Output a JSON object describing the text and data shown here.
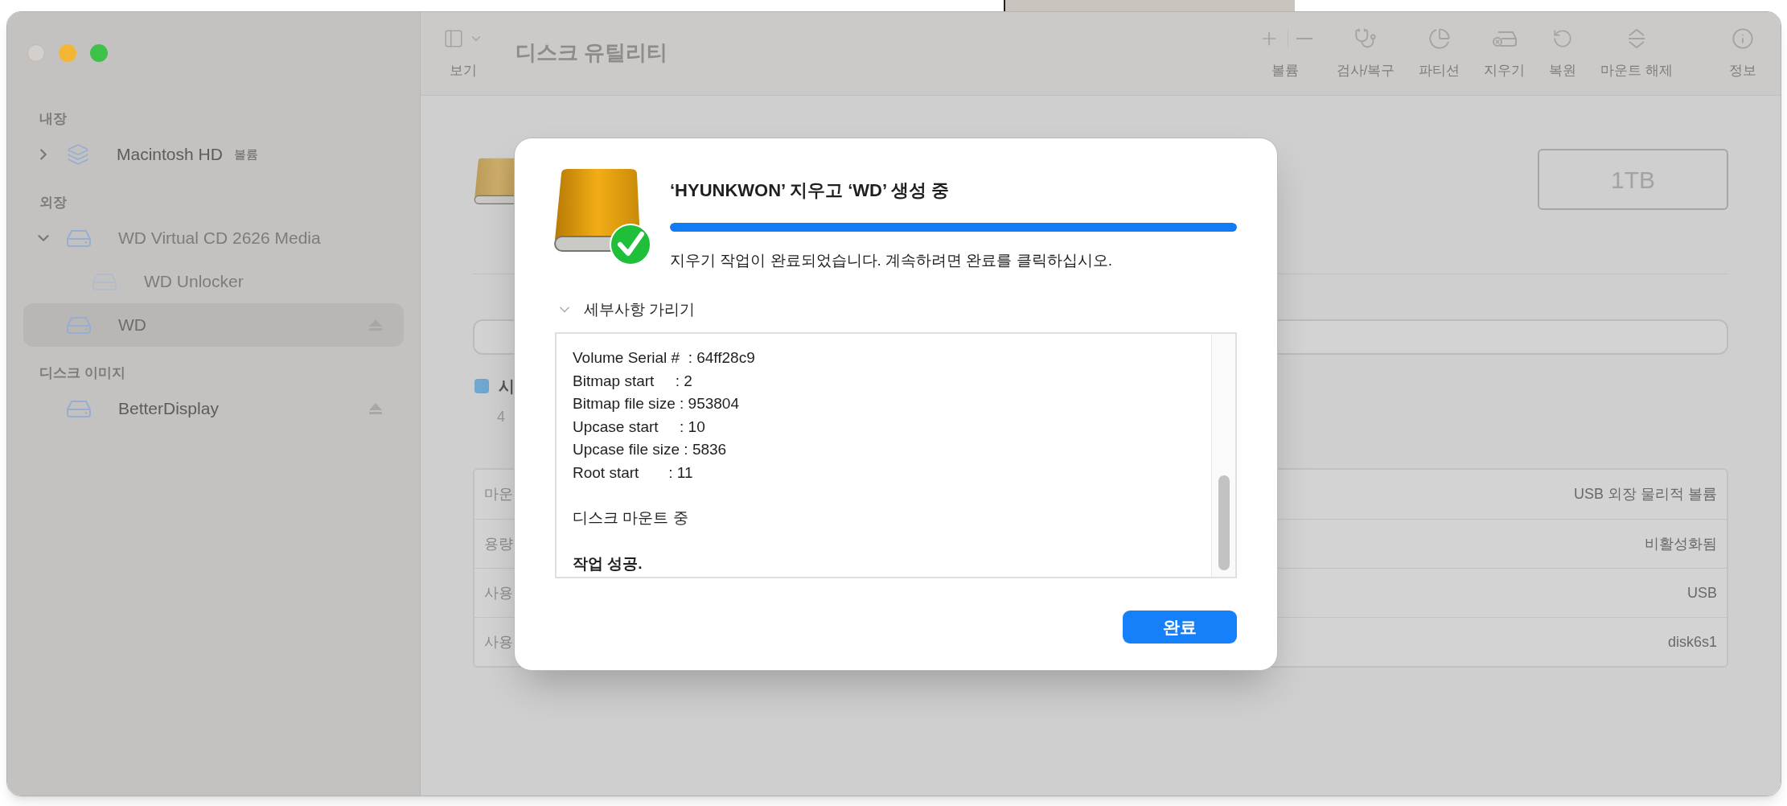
{
  "window": {
    "title": "디스크 유틸리티",
    "view_label": "보기"
  },
  "toolbar": {
    "buttons": [
      {
        "kind": "volume",
        "label": "볼륨"
      },
      {
        "kind": "firstaid",
        "label": "검사/복구"
      },
      {
        "kind": "partition",
        "label": "파티션"
      },
      {
        "kind": "erase",
        "label": "지우기"
      },
      {
        "kind": "restore",
        "label": "복원"
      },
      {
        "kind": "unmount",
        "label": "마운트 해제"
      },
      {
        "kind": "info",
        "label": "정보"
      }
    ]
  },
  "sidebar": {
    "sections": [
      {
        "title": "내장",
        "items": [
          {
            "kind": "volume",
            "label": "Macintosh HD",
            "badge": "볼륨",
            "expanded": false,
            "selected": false,
            "disabled": false
          }
        ]
      },
      {
        "title": "외장",
        "items": [
          {
            "kind": "drive",
            "label": "WD Virtual CD 2626 Media",
            "expanded": true,
            "selected": false,
            "disabled": true,
            "children": [
              {
                "kind": "drive",
                "label": "WD Unlocker",
                "selected": false,
                "disabled": true
              }
            ]
          },
          {
            "kind": "drive",
            "label": "WD",
            "selected": true,
            "disabled": false,
            "ejectable": true
          }
        ]
      },
      {
        "title": "디스크 이미지",
        "items": [
          {
            "kind": "drive",
            "label": "BetterDisplay",
            "selected": false,
            "disabled": false,
            "ejectable": true
          }
        ]
      }
    ]
  },
  "volume": {
    "capacity": "1TB",
    "legend": {
      "label": "시",
      "detail": "4"
    },
    "table": {
      "rows": [
        {
          "label": "마운",
          "value": "USB 외장 물리적 볼륨"
        },
        {
          "label": "용량",
          "value": "비활성화됨"
        },
        {
          "label": "사용",
          "value": "USB"
        },
        {
          "label": "사용",
          "value": "disk6s1"
        }
      ]
    }
  },
  "dialog": {
    "title": "‘HYUNKWON’ 지우고 ‘WD’ 생성 중",
    "progress": {
      "level": 1
    },
    "message": "지우기 작업이 완료되었습니다. 계속하려면 완료를 클릭하십시오.",
    "details": {
      "label": "세부사항 가리기",
      "expanded": true
    },
    "log": [
      {
        "bold": false,
        "lines": [
          "Volume Serial #  : 64ff28c9",
          "Bitmap start     : 2",
          "Bitmap file size : 953804",
          "Upcase start     : 10",
          "Upcase file size : 5836",
          "Root start       : 11"
        ]
      },
      {
        "bold": false,
        "lines": [
          "디스크 마운트 중"
        ]
      },
      {
        "bold": true,
        "lines": [
          "작업 성공."
        ]
      }
    ],
    "button": "완료"
  }
}
